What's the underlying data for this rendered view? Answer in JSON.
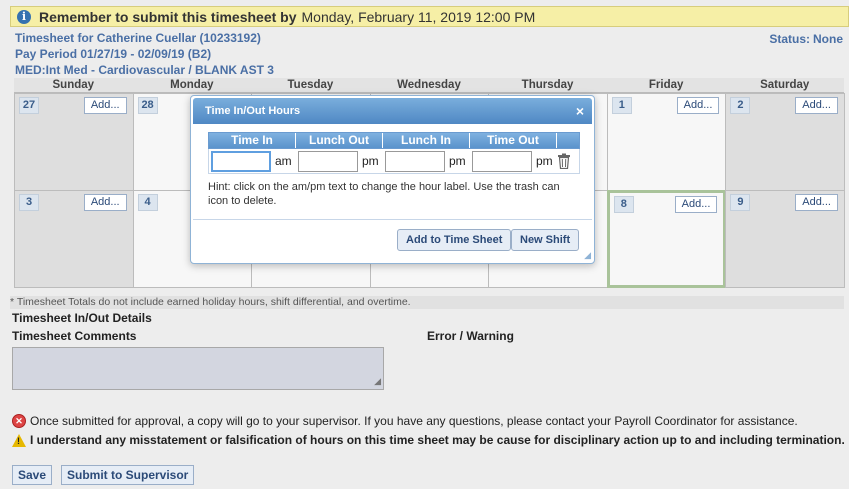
{
  "banner": {
    "prefix": "Remember to submit this timesheet by",
    "deadline": "Monday, February 11, 2019 12:00 PM"
  },
  "header": {
    "employee": "Timesheet for Catherine Cuellar (10233192)",
    "pay_period": "Pay Period 01/27/19 - 02/09/19 (B2)",
    "department": "MED:Int Med - Cardiovascular / BLANK AST 3",
    "status_label": "Status:",
    "status_value": "None"
  },
  "calendar": {
    "days": [
      "Sunday",
      "Monday",
      "Tuesday",
      "Wednesday",
      "Thursday",
      "Friday",
      "Saturday"
    ],
    "add_label": "Add...",
    "week1": [
      "27",
      "28",
      "",
      "",
      "",
      "1",
      "2"
    ],
    "week2": [
      "3",
      "4",
      "",
      "",
      "",
      "8",
      "9"
    ]
  },
  "note": "* Timesheet Totals do not include earned holiday hours, shift differential, and overtime.",
  "sections": {
    "inout": "Timesheet In/Out Details",
    "comments": "Timesheet Comments",
    "errors": "Error / Warning"
  },
  "messages": {
    "approval": "Once submitted for approval, a copy will go to your supervisor. If you have any questions, please contact your Payroll Coordinator for assistance.",
    "warning": "I understand any misstatement or falsification of hours on this time sheet may be cause for disciplinary action up to and including termination."
  },
  "buttons": {
    "save": "Save",
    "submit": "Submit to Supervisor"
  },
  "dialog": {
    "title": "Time In/Out Hours",
    "close": "×",
    "columns": [
      "Time In",
      "Lunch Out",
      "Lunch In",
      "Time Out"
    ],
    "suffixes": [
      "am",
      "pm",
      "pm",
      "pm"
    ],
    "hint": "Hint: click on the am/pm text to change the hour label. Use the trash can icon to delete.",
    "add_button": "Add to Time Sheet",
    "new_shift_button": "New Shift"
  }
}
